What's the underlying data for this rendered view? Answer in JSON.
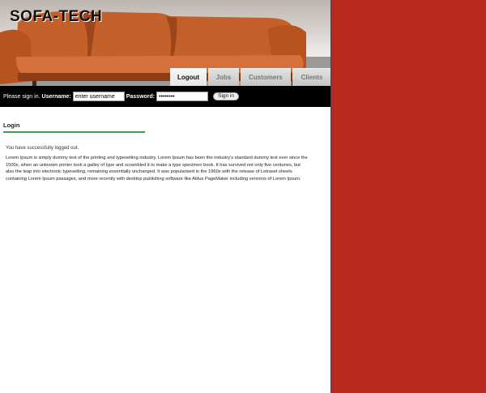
{
  "brand": {
    "logo_text": "SOFA-TECH"
  },
  "nav": {
    "tabs": [
      {
        "label": "Logout",
        "active": true
      },
      {
        "label": "Jobs",
        "active": false
      },
      {
        "label": "Customers",
        "active": false
      },
      {
        "label": "Clients",
        "active": false
      }
    ]
  },
  "login_bar": {
    "prompt": "Please sign in.",
    "username_label": "Username:",
    "username_value": "enter username",
    "password_label": "Password:",
    "password_value": "••••••••",
    "signin_label": "Sign in"
  },
  "content": {
    "heading": "Login",
    "status_message": "You have successfully logged out.",
    "body_text": "Lorem Ipsum is simply dummy text of the printing and typesetting industry. Lorem Ipsum has been the industry's standard dummy text ever since the 1500s, when an unknown printer took a galley of type and scrambled it to make a type specimen book. It has survived not only five centuries, but also the leap into electronic typesetting, remaining essentially unchanged. It was popularised in the 1960s with the release of Letraset sheets containing Lorem Ipsum passages, and more recently with desktop publishing software like Aldus PageMaker including versions of Lorem Ipsum."
  },
  "colors": {
    "side_panel": "#b8281c",
    "sofa": "#c8612a",
    "heading_underline": "#3aa04a",
    "login_bar": "#000000"
  }
}
